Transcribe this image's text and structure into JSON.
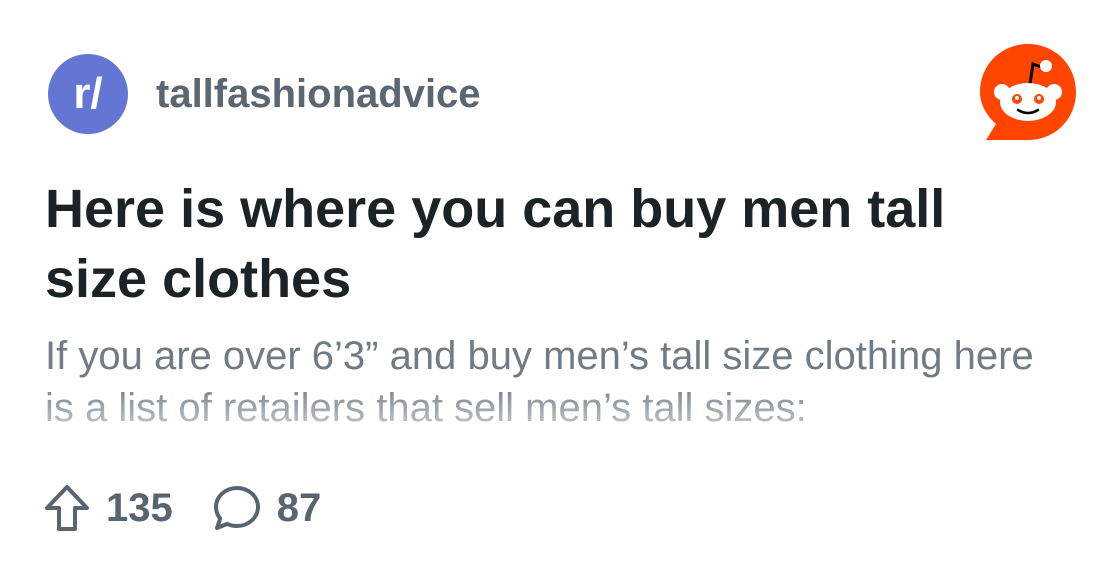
{
  "subreddit": {
    "avatar_text": "r/",
    "name": "tallfashionadvice",
    "avatar_color": "#6376d4"
  },
  "logo": {
    "icon": "reddit-snoo-icon",
    "color": "#ff4500"
  },
  "post": {
    "title": "Here is where you can buy men tall size clothes",
    "body": "If you are over 6’3” and buy men’s tall size clothing here is a list of retailers that sell men’s tall sizes:"
  },
  "stats": {
    "upvotes": "135",
    "upvote_icon": "upvote-arrow-icon",
    "comments": "87",
    "comment_icon": "comment-bubble-icon"
  },
  "colors": {
    "title": "#1c2327",
    "body": "#717b83",
    "meta": "#58656e"
  }
}
